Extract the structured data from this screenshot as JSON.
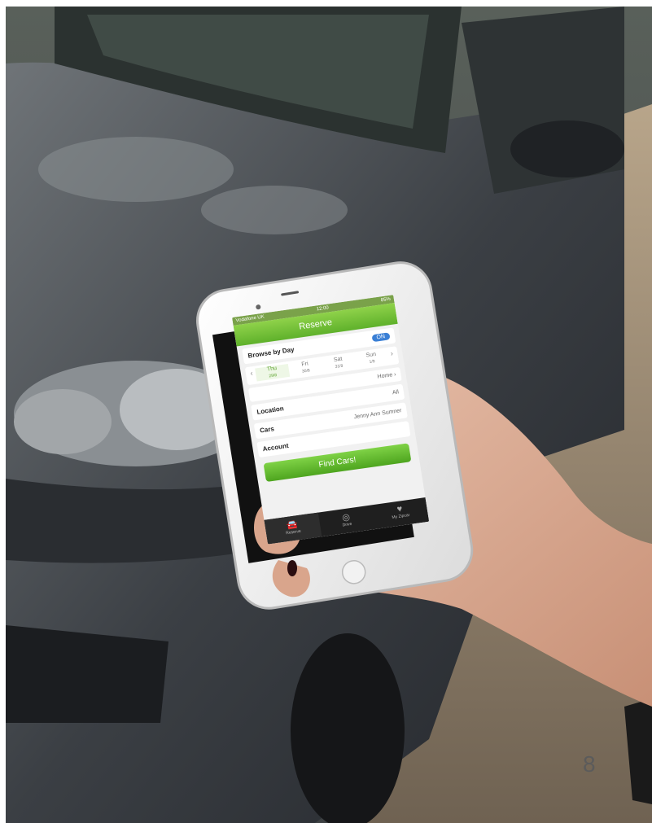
{
  "phone_screen": {
    "status": {
      "carrier": "Vodafone UK",
      "time": "12:00",
      "battery": "85%"
    },
    "nav_title": "Reserve",
    "browse_by_day": {
      "label": "Browse by Day",
      "toggle": "ON"
    },
    "days": [
      {
        "day": "Thu",
        "date": "29/8",
        "active": true
      },
      {
        "day": "Fri",
        "date": "30/8",
        "active": false
      },
      {
        "day": "Sat",
        "date": "31/8",
        "active": false
      },
      {
        "day": "Sun",
        "date": "1/9",
        "active": false
      }
    ],
    "home_label": "Home",
    "location": {
      "label": "Location",
      "value": "All"
    },
    "cars": {
      "label": "Cars",
      "value": "Jenny Ann Sumner"
    },
    "account": {
      "label": "Account",
      "value": ""
    },
    "find_button": "Find Cars!",
    "tabs": [
      {
        "label": "Reserve",
        "icon": "car-icon",
        "active": true
      },
      {
        "label": "Drive",
        "icon": "steering-wheel-icon",
        "active": false
      },
      {
        "label": "My Zipcar",
        "icon": "heart-icon",
        "active": false
      }
    ],
    "accent": "#5fb12b"
  },
  "page_number": "8"
}
